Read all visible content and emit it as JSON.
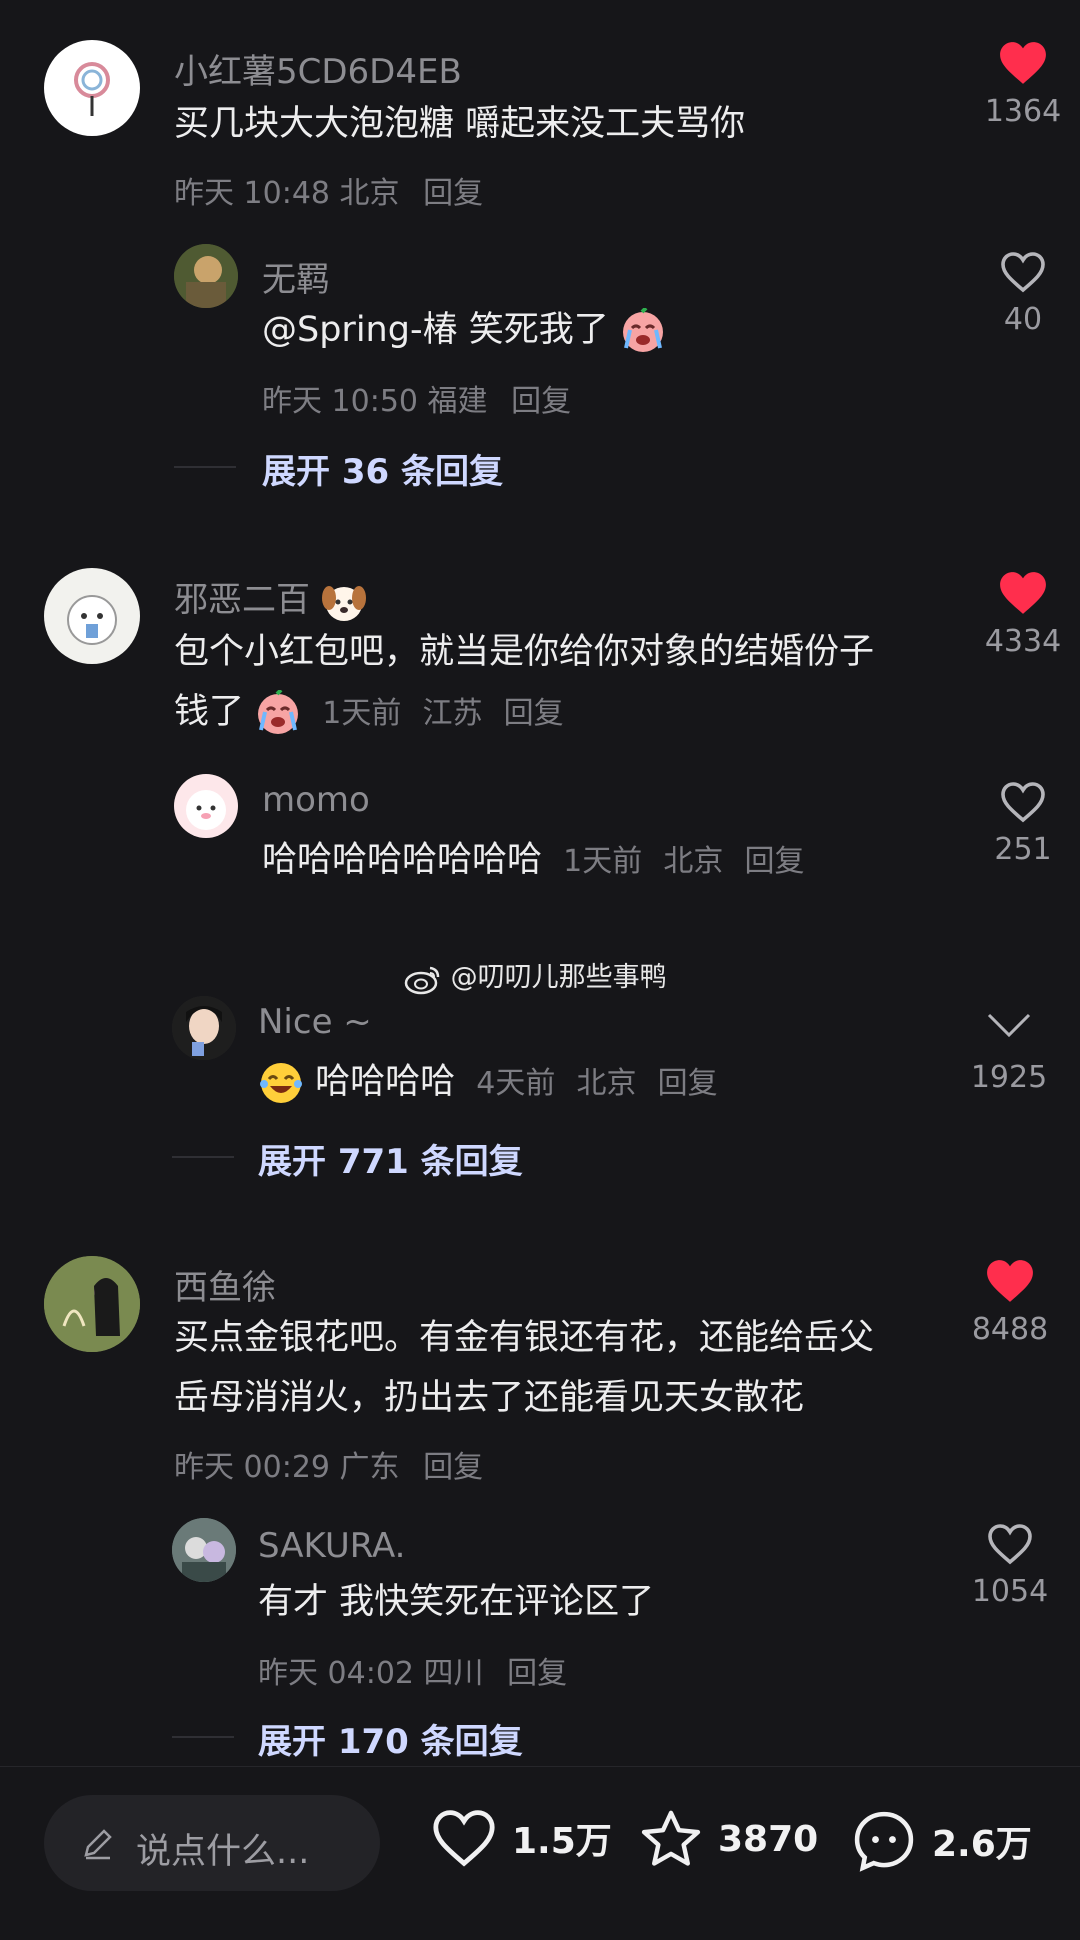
{
  "comments": [
    {
      "username": "小红薯5CD6D4EB",
      "text_lines": [
        "买几块大大泡泡糖 嚼起来没工夫骂你"
      ],
      "time": "昨天 10:48",
      "location": "北京",
      "reply_label": "回复",
      "likes": "1364",
      "liked": true,
      "replies": [
        {
          "username": "无羁",
          "text": "@Spring-椿 笑死我了",
          "time": "昨天 10:50",
          "location": "福建",
          "reply_label": "回复",
          "likes": "40",
          "liked": false
        }
      ],
      "expand_label": "展开 36 条回复"
    },
    {
      "username": "邪恶二百",
      "text_lines": [
        "包个小红包吧，就当是你给你对象的结婚份子",
        "钱了"
      ],
      "time": "1天前",
      "location": "江苏",
      "reply_label": "回复",
      "likes": "4334",
      "liked": true,
      "replies": [
        {
          "username": "momo",
          "text": "哈哈哈哈哈哈哈哈",
          "time": "1天前",
          "location": "北京",
          "reply_label": "回复",
          "likes": "251",
          "liked": false
        },
        {
          "username": "Nice ~",
          "text": "哈哈哈哈",
          "time": "4天前",
          "location": "北京",
          "reply_label": "回复",
          "likes": "1925",
          "liked": false
        }
      ],
      "expand_label": "展开 771 条回复"
    },
    {
      "username": "西鱼徐",
      "text_lines": [
        "买点金银花吧。有金有银还有花，还能给岳父",
        "岳母消消火，扔出去了还能看见天女散花"
      ],
      "time": "昨天 00:29",
      "location": "广东",
      "reply_label": "回复",
      "likes": "8488",
      "liked": true,
      "replies": [
        {
          "username": "SAKURA.",
          "text": "有才 我快笑死在评论区了",
          "time": "昨天 04:02",
          "location": "四川",
          "reply_label": "回复",
          "likes": "1054",
          "liked": false
        }
      ],
      "expand_label": "展开 170 条回复"
    }
  ],
  "watermark": "@叨叨儿那些事鸭",
  "bottom_bar": {
    "input_placeholder": "说点什么...",
    "likes": "1.5万",
    "favorites": "3870",
    "comments": "2.6万"
  },
  "colors": {
    "background": "#161619",
    "heart_red": "#ff2e4d",
    "expand_text": "#cfd8ff"
  }
}
